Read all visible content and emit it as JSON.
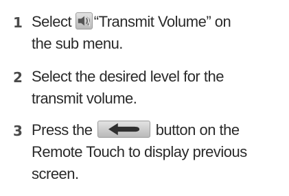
{
  "steps": [
    {
      "number": "1",
      "lines": [
        {
          "before": "Select",
          "icon": "speaker-volume-icon",
          "after": "“Transmit Volume” on"
        },
        {
          "text": "the sub menu."
        }
      ]
    },
    {
      "number": "2",
      "lines": [
        {
          "text": "Select the desired level for the"
        },
        {
          "text": "transmit volume."
        }
      ]
    },
    {
      "number": "3",
      "lines": [
        {
          "before": "Press the",
          "icon": "back-arrow-icon",
          "after": "button on the"
        },
        {
          "text": "Remote Touch to display previous"
        },
        {
          "text": "screen."
        }
      ]
    }
  ]
}
